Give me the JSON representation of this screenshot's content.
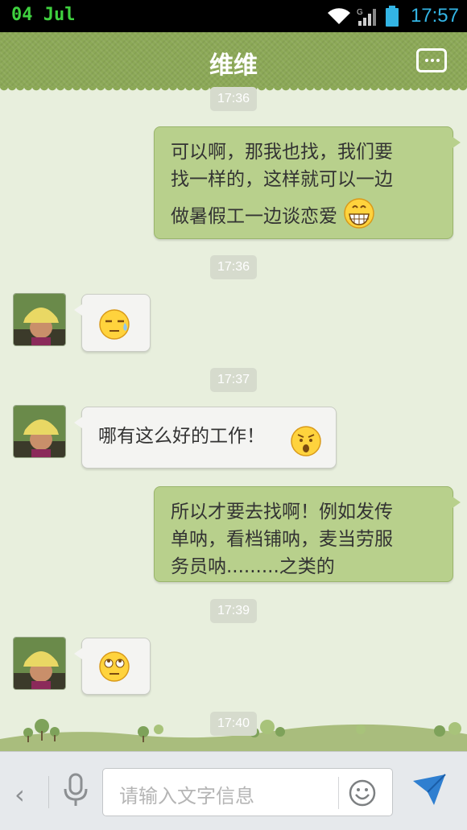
{
  "status_bar": {
    "date": "04  Jul",
    "time": "17:57"
  },
  "header": {
    "title": "维维"
  },
  "colors": {
    "header_green": "#8ca957",
    "my_bubble": "#b8d08c",
    "other_bubble": "#f4f4f2",
    "send_blue": "#2f7fd0"
  },
  "messages": [
    {
      "timestamp": "17:36"
    },
    {
      "sender": "me",
      "lines": [
        "可以啊，那我也找，我们要",
        "找一样的，这样就可以一边",
        "做暑假工一边谈恋爱"
      ],
      "emoji": "grin-emoji"
    },
    {
      "timestamp": "17:36"
    },
    {
      "sender": "other",
      "emoji": "sweat-emoji"
    },
    {
      "timestamp": "17:37"
    },
    {
      "sender": "other",
      "lines": [
        "哪有这么好的工作！"
      ],
      "emoji": "surprised-emoji"
    },
    {
      "sender": "me",
      "lines": [
        "所以才要去找啊！例如发传",
        "单呐，看档铺呐，麦当劳服",
        "务员呐.........之类的"
      ]
    },
    {
      "timestamp": "17:39"
    },
    {
      "sender": "other",
      "emoji": "rolling-eyes-emoji"
    },
    {
      "timestamp": "17:40"
    }
  ],
  "input_bar": {
    "placeholder": "请输入文字信息"
  }
}
